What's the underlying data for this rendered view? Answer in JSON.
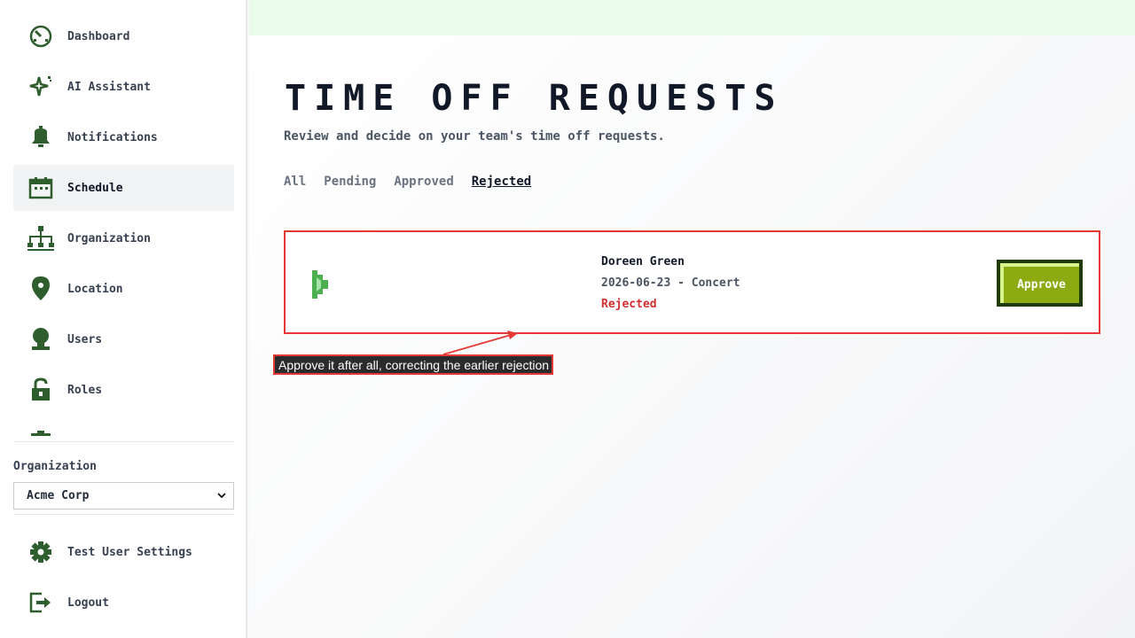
{
  "sidebar": {
    "items": [
      {
        "label": "Dashboard",
        "icon": "dashboard-icon"
      },
      {
        "label": "AI Assistant",
        "icon": "sparkle-icon"
      },
      {
        "label": "Notifications",
        "icon": "bell-icon"
      },
      {
        "label": "Schedule",
        "icon": "calendar-icon",
        "active": true
      },
      {
        "label": "Organization",
        "icon": "org-chart-icon"
      },
      {
        "label": "Location",
        "icon": "map-pin-icon"
      },
      {
        "label": "Users",
        "icon": "user-icon"
      },
      {
        "label": "Roles",
        "icon": "lock-icon"
      }
    ],
    "organization_label": "Organization",
    "organization_value": "Acme Corp",
    "settings_label": "Test User Settings",
    "logout_label": "Logout"
  },
  "page": {
    "title": "TIME OFF REQUESTS",
    "subtitle": "Review and decide on your team's time off requests."
  },
  "tabs": [
    {
      "label": "All"
    },
    {
      "label": "Pending"
    },
    {
      "label": "Approved"
    },
    {
      "label": "Rejected",
      "active": true
    }
  ],
  "request": {
    "name": "Doreen Green",
    "details": "2026-06-23 - Concert",
    "status": "Rejected",
    "approve_label": "Approve"
  },
  "annotation": {
    "text": "Approve it after all, correcting the earlier rejection"
  },
  "colors": {
    "accent_green": "#2e5d2e",
    "topbar": "#ecfcea",
    "rejected_red": "#d32f2f",
    "approve_button": "#8cab12",
    "highlight_border": "#e53935"
  }
}
